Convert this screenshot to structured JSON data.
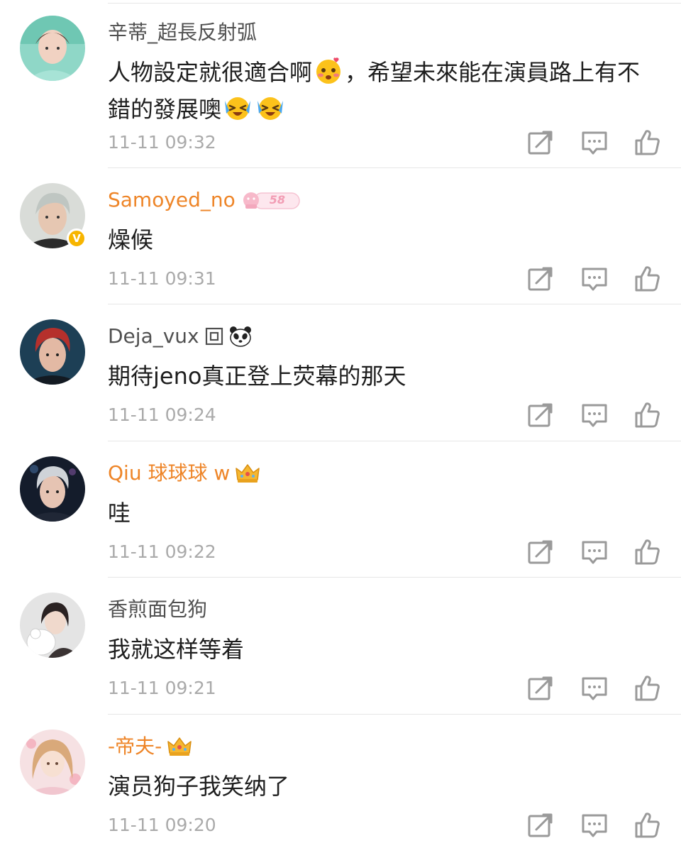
{
  "comments": [
    {
      "username": "辛蒂_超長反射弧",
      "text_parts": [
        "人物設定就很適合啊",
        "，希望未來能在演員路上有不錯的發展噢"
      ],
      "timestamp": "11-11 09:32",
      "inline_icons": [
        "blushing-face-emoji",
        "crying-laughing-emoji",
        "crying-laughing-emoji"
      ]
    },
    {
      "username": "Samoyed_no",
      "username_color": "#ee8528",
      "badge_icon": "member-badge-icon",
      "badge_text": "58",
      "avatar_badge": "V",
      "text": "燥候",
      "timestamp": "11-11 09:31"
    },
    {
      "username": "Deja_vux",
      "badge_icon": "panda-icon",
      "text": "期待jeno真正登上荧幕的那天",
      "timestamp": "11-11 09:24"
    },
    {
      "username": "Qiu 球球球 w",
      "username_color": "#ee8528",
      "badge_icon": "crown-icon",
      "text": "哇",
      "timestamp": "11-11 09:22"
    },
    {
      "username": "香煎面包狗",
      "text": "我就这样等着",
      "timestamp": "11-11 09:21"
    },
    {
      "username": "-帝夫-",
      "username_color": "#ee8528",
      "badge_icon": "crown-icon",
      "text": "演员狗子我笑纳了",
      "timestamp": "11-11 09:20"
    }
  ],
  "action_icons": [
    "share-icon",
    "comment-icon",
    "like-icon"
  ],
  "colors": {
    "member_name": "#ee8528",
    "username": "#505050",
    "timestamp": "#aaaaaa",
    "icon_gray": "#9a9a9a",
    "verified": "#f7b500"
  }
}
